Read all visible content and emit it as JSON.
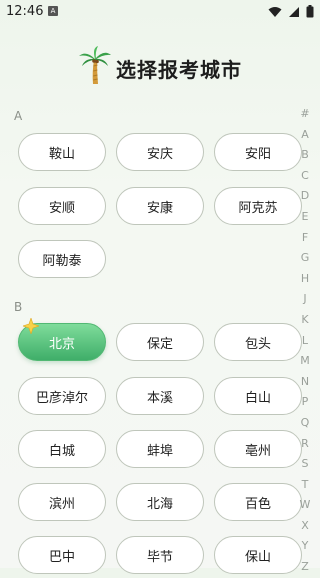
{
  "status": {
    "time": "12:46",
    "app_badge": "A"
  },
  "header": {
    "title": "选择报考城市"
  },
  "sections": [
    {
      "letter": "A",
      "cities": [
        "鞍山",
        "安庆",
        "安阳",
        "安顺",
        "安康",
        "阿克苏",
        "阿勒泰"
      ]
    },
    {
      "letter": "B",
      "cities": [
        "北京",
        "保定",
        "包头",
        "巴彦淖尔",
        "本溪",
        "白山",
        "白城",
        "蚌埠",
        "亳州",
        "滨州",
        "北海",
        "百色",
        "巴中",
        "毕节",
        "保山"
      ]
    }
  ],
  "selected_city": "北京",
  "index_letters": [
    "#",
    "A",
    "B",
    "C",
    "D",
    "E",
    "F",
    "G",
    "H",
    "J",
    "K",
    "L",
    "M",
    "N",
    "P",
    "Q",
    "R",
    "S",
    "T",
    "W",
    "X",
    "Y",
    "Z"
  ],
  "colors": {
    "accent": "#4cb676",
    "border": "#bfc6bb"
  }
}
